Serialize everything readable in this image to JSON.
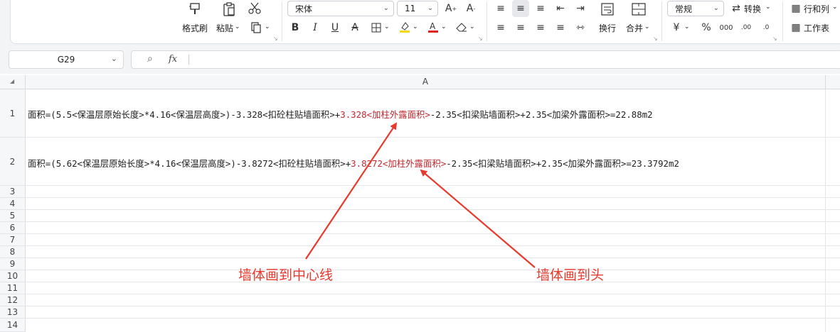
{
  "ribbon": {
    "format_painter": "格式刷",
    "paste": "粘贴",
    "font_name": "宋体",
    "font_size": "11",
    "wrap_text": "换行",
    "merge": "合并",
    "number_format": "常规",
    "convert": "转换",
    "rows_cols": "行和列",
    "worksheet": "工作表",
    "accent_red": "#e02020",
    "highlight_yellow": "#f5d90a"
  },
  "formula_bar": {
    "cell_ref": "G29",
    "fx": "fx"
  },
  "sheet": {
    "column_a": "A",
    "rows": [
      "1",
      "2",
      "3",
      "4",
      "5",
      "6",
      "7",
      "8",
      "9",
      "10",
      "11",
      "12",
      "13",
      "14"
    ],
    "row1": {
      "pre": "面积=(5.5<保温层原始长度>*4.16<保温层高度>)-3.328<扣砼柱贴墙面积>+",
      "red": "3.328<加柱外露面积>",
      "post": "-2.35<扣梁贴墙面积>+2.35<加梁外露面积>=22.88m2"
    },
    "row2": {
      "pre": "面积=(5.62<保温层原始长度>*4.16<保温层高度>)-3.8272<扣砼柱贴墙面积>+",
      "red": "3.8272<加柱外露面积>",
      "post": "-2.35<扣梁贴墙面积>+2.35<加梁外露面积>=23.3792m2"
    }
  },
  "annotations": {
    "left": "墙体画到中心线",
    "right": "墙体画到头",
    "color": "#e8392d"
  }
}
